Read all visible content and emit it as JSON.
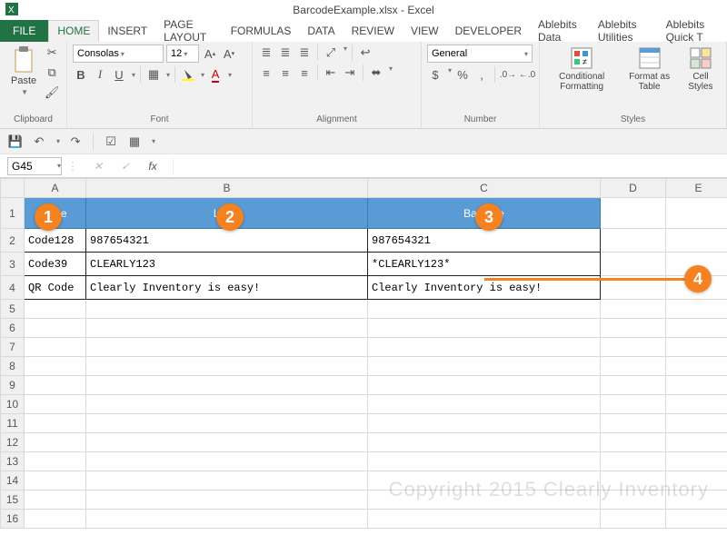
{
  "app": {
    "title": "BarcodeExample.xlsx - Excel"
  },
  "tabs": {
    "file": "FILE",
    "home": "HOME",
    "insert": "INSERT",
    "pagelayout": "PAGE LAYOUT",
    "formulas": "FORMULAS",
    "data": "DATA",
    "review": "REVIEW",
    "view": "VIEW",
    "developer": "DEVELOPER",
    "ab_data": "Ablebits Data",
    "ab_util": "Ablebits Utilities",
    "ab_quick": "Ablebits Quick T"
  },
  "ribbon": {
    "clipboard": {
      "paste": "Paste",
      "label": "Clipboard"
    },
    "font": {
      "name": "Consolas",
      "size": "12",
      "label": "Font"
    },
    "align": {
      "label": "Alignment"
    },
    "number": {
      "format": "General",
      "label": "Number"
    },
    "styles": {
      "cf": "Conditional Formatting",
      "fat": "Format as Table",
      "cs": "Cell Styles",
      "label": "Styles"
    }
  },
  "qat": {
    "save": "💾",
    "undo": "↶",
    "redo": "↷"
  },
  "fbar": {
    "namebox": "G45"
  },
  "cols": {
    "A": "A",
    "B": "B",
    "C": "C",
    "D": "D",
    "E": "E"
  },
  "header": {
    "type": "Type",
    "label": "Label",
    "barcode": "Barcode"
  },
  "rows": [
    {
      "type": "Code128",
      "label": "987654321",
      "barcode": "987654321"
    },
    {
      "type": "Code39",
      "label": "CLEARLY123",
      "barcode": "*CLEARLY123*"
    },
    {
      "type": "QR Code",
      "label": "Clearly Inventory is easy!",
      "barcode": "Clearly Inventory is easy!"
    }
  ],
  "callouts": {
    "c1": "1",
    "c2": "2",
    "c3": "3",
    "c4": "4"
  },
  "watermark": "Copyright 2015 Clearly Inventory"
}
